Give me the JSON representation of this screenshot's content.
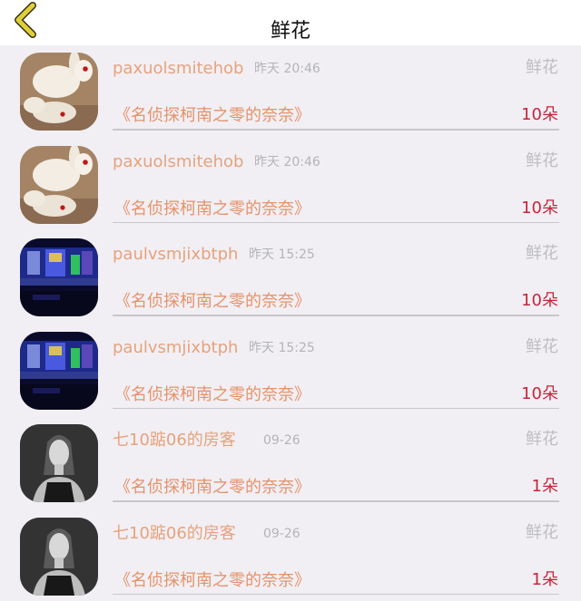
{
  "header": {
    "title": "鲜花",
    "back_icon": "chevron-left-icon",
    "back_color": "#e0cf3a"
  },
  "items": [
    {
      "name": "paxuolsmitehob",
      "time": "昨天 20:46",
      "gift": "鲜花",
      "work": "《名侦探柯南之零的奈奈》",
      "count": "10朵",
      "avatar": "rabbit-avatar"
    },
    {
      "name": "paxuolsmitehob",
      "time": "昨天 20:46",
      "gift": "鲜花",
      "work": "《名侦探柯南之零的奈奈》",
      "count": "10朵",
      "avatar": "rabbit-avatar"
    },
    {
      "name": "paulvsmjixbtph",
      "time": "昨天 15:25",
      "gift": "鲜花",
      "work": "《名侦探柯南之零的奈奈》",
      "count": "10朵",
      "avatar": "stage-avatar"
    },
    {
      "name": "paulvsmjixbtph",
      "time": "昨天 15:25",
      "gift": "鲜花",
      "work": "《名侦探柯南之零的奈奈》",
      "count": "10朵",
      "avatar": "stage-avatar"
    },
    {
      "name": "七10踮06的房客",
      "time": "09-26",
      "gift": "鲜花",
      "work": "《名侦探柯南之零的奈奈》",
      "count": "1朵",
      "avatar": "portrait-avatar"
    },
    {
      "name": "七10踮06的房客",
      "time": "09-26",
      "gift": "鲜花",
      "work": "《名侦探柯南之零的奈奈》",
      "count": "1朵",
      "avatar": "portrait-avatar"
    }
  ]
}
